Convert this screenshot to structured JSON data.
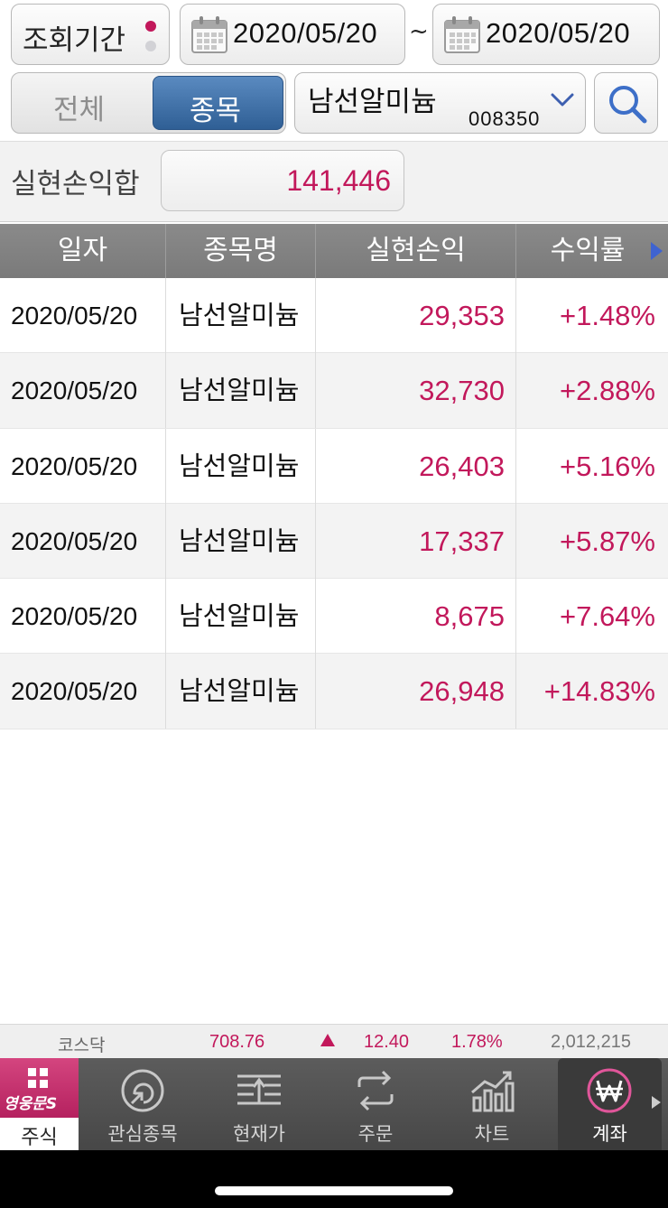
{
  "query": {
    "period_label": "조회기간",
    "date_from": "2020/05/20",
    "separator": "~",
    "date_to": "2020/05/20"
  },
  "filter": {
    "all_label": "전체",
    "item_label": "종목",
    "selected": "종목"
  },
  "stock": {
    "name": "남선알미늄",
    "code": "008350"
  },
  "summary": {
    "label": "실현손익합",
    "value": "141,446"
  },
  "table": {
    "columns": [
      "일자",
      "종목명",
      "실현손익",
      "수익률"
    ],
    "rows": [
      {
        "date": "2020/05/20",
        "name": "남선알미늄",
        "pnl": "29,353",
        "rate": "+1.48%"
      },
      {
        "date": "2020/05/20",
        "name": "남선알미늄",
        "pnl": "32,730",
        "rate": "+2.88%"
      },
      {
        "date": "2020/05/20",
        "name": "남선알미늄",
        "pnl": "26,403",
        "rate": "+5.16%"
      },
      {
        "date": "2020/05/20",
        "name": "남선알미늄",
        "pnl": "17,337",
        "rate": "+5.87%"
      },
      {
        "date": "2020/05/20",
        "name": "남선알미늄",
        "pnl": "8,675",
        "rate": "+7.64%"
      },
      {
        "date": "2020/05/20",
        "name": "남선알미늄",
        "pnl": "26,948",
        "rate": "+14.83%"
      }
    ]
  },
  "ticker": {
    "market": "코스닥",
    "index": "708.76",
    "direction": "up",
    "change": "12.40",
    "change_pct": "1.78%",
    "volume": "2,012,215"
  },
  "nav": {
    "brand": "영웅문S",
    "items": [
      {
        "label": "주식",
        "icon": "grid-icon"
      },
      {
        "label": "관심종목",
        "icon": "watchlist-icon"
      },
      {
        "label": "현재가",
        "icon": "price-icon"
      },
      {
        "label": "주문",
        "icon": "order-icon"
      },
      {
        "label": "차트",
        "icon": "chart-icon"
      },
      {
        "label": "계좌",
        "icon": "won-icon"
      }
    ],
    "active": "계좌"
  },
  "colors": {
    "accent": "#c2185b",
    "segment_active": "#3a6aa0",
    "header_gray": "#828282"
  }
}
